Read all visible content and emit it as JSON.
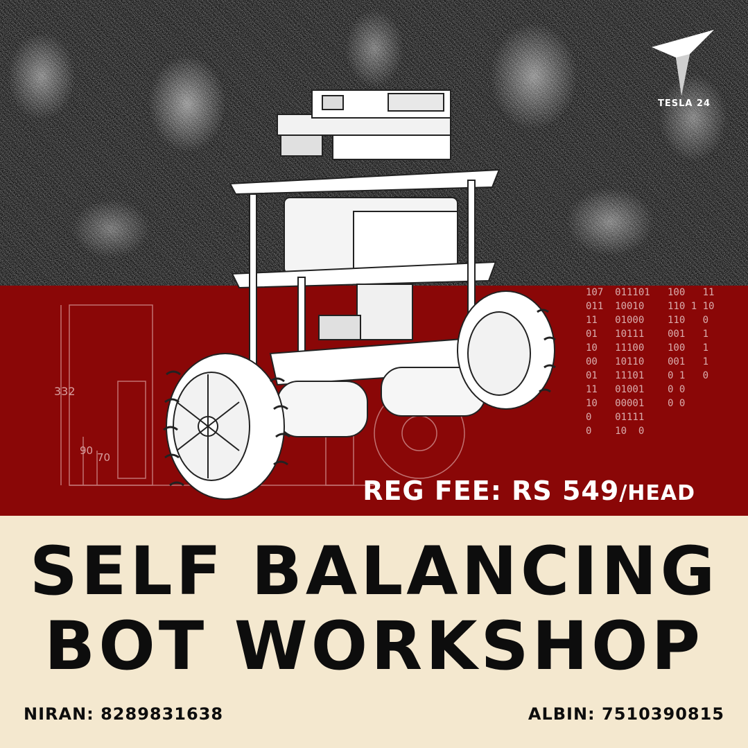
{
  "brand": {
    "name": "TESLA 24",
    "logo_icon": "tesla24-logo-icon"
  },
  "fee": {
    "label": "REG FEE: RS 549",
    "per": "/HEAD"
  },
  "title": {
    "line1": "SELF BALANCING",
    "line2": "BOT WORKSHOP"
  },
  "contacts": [
    {
      "text": "NIRAN: 8289831638"
    },
    {
      "text": "ALBIN: 7510390815"
    }
  ],
  "diagram_labels": {
    "height": "332",
    "a": "90",
    "b": "70"
  },
  "binary_text": "107  011101   100   11\n011  10010    110 1 10\n11   01000    110   0\n01   10111    001   1\n10   11100    100   1\n00   10110    001   1\n01   11101    0 1   0\n11   01001    0 0\n10   00001    0 0\n0    01111\n0    10  0",
  "colors": {
    "red": "#8a0707",
    "cream": "#f4e8cf",
    "ink": "#0d0d0d"
  }
}
